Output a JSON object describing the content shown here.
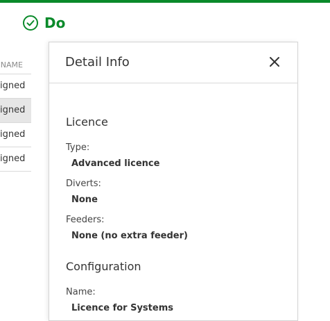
{
  "header": {
    "title": "Do",
    "icon": "check-circle-icon",
    "accent_color": "#0a8a2a"
  },
  "table": {
    "column_header": "NAME",
    "rows": [
      "igned",
      "igned",
      "igned",
      "igned"
    ],
    "selected_index": 1
  },
  "detail": {
    "title": "Detail Info",
    "close_icon": "close-icon",
    "licence": {
      "section_title": "Licence",
      "type_label": "Type:",
      "type_value": "Advanced licence",
      "diverts_label": "Diverts:",
      "diverts_value": "None",
      "feeders_label": "Feeders:",
      "feeders_value": "None (no extra feeder)"
    },
    "configuration": {
      "section_title": "Configuration",
      "name_label": "Name:",
      "name_value": "Licence for Systems"
    }
  }
}
